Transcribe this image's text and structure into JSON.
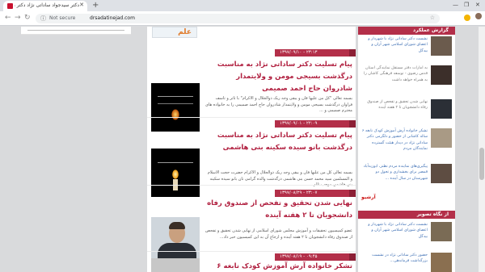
{
  "browser": {
    "tab_title": "دکتر سیدجواد ساداتی نژاد دکتر م...",
    "new_tab": "+",
    "not_secure": "Not secure",
    "url": "drsadatinejad.com"
  },
  "ad_text": "علم",
  "posts": [
    {
      "date": "۱۳۹۷/۰۹/۱۰ - ۲۳:۱۳",
      "title": "پیام تسلیت دکتر ساداتی نژاد به مناسبت درگذشت بسیجی مومن و ولایتمدار شادروان حاج احمد صمیمی",
      "excerpt": "بسمه تعالی \"کل من علیها فان و یبقی وجه ربک ذوالجلال و الاکرام\" با تاثر و تاسف فراوان درگذشت بسیجی مومن و ولایتمدار شادروان حاج احمد صمیمی را به خانواده های محترم صمیمی و ..."
    },
    {
      "date": "۱۳۹۷/۰۹/۰۱ - ۲۲:۰۹",
      "title": "پیام تسلیت دکتر ساداتی نژاد به مناسبت درگذشت بانو سیده سکینه بنی هاشمی",
      "excerpt": "بسمه تعالی کل من علیها فان و یبقی وجه ربک ذوالجلال و الاکرام حضرت حجت الاسلام و المسلمین سید محمد حسن بنی هاشمی درگذشت والده گرامی تان بانو سیده سکینه بنی هاشمی موجب تالم..."
    },
    {
      "date": "۱۳۹۷/۰۸/۲۹ - ۲۳:۰۷",
      "title": "نهایی شدن تحقیق و تفحص از صندوق رفاه دانشجویان تا ۲ هفته آینده",
      "excerpt": "عضو کمیسیون تحقیقات و آموزش مجلس شورای اسلامی از نهایی شدن تحقیق و تفحص از صندوق رفاه دانشجویان تا ۲ هفته آینده و ارجاع آن به این کمیسیون خبر داد..."
    },
    {
      "date": "۱۳۹۷/۰۸/۱۹ - ۰۹:۴۵",
      "title": "تشکر خانواده آرش آموزش کودک نابغه ۶ ساله کاشانی از"
    }
  ],
  "sidebar": {
    "reports_header": "گزارش عملکرد",
    "reports": [
      "نشست دکتر ساداتی نژاد با شهردار و اعضای شورای اسلامی شهر آران و بیدگل",
      "به امارات دفتر مستقل نمایندگی استان قدس رضوی - توسعه فرهنگی کاشان را به همراه خواهد داشت",
      "نهایی شدن تحقیق و تفحص از صندوق رفاه دانشجویان تا ۲ هفته آینده",
      "تشکر خانواده آرش آموزش کودک نابغه ۶ ساله کاشانی از حضور و دلگرمی دکتر ساداتی نژاد در دیدار هیئت گسترده نمایندگان مردم",
      "پیگیری‌های نماینده مردم نطنز، ابوزیدآباد قمصر برای بخشداری و تحول دو شهرستان در سال آینده ..."
    ],
    "more": "آرشیو",
    "gallery_header": "از نگاه تصویر",
    "gallery": [
      "نشست دکتر ساداتی نژاد با شهردار و اعضای شورای اسلامی شهر آران و بیدگل",
      "حضور دکتر ساداتی نژاد در نشست بزرگداشت فرماندهی..."
    ]
  }
}
